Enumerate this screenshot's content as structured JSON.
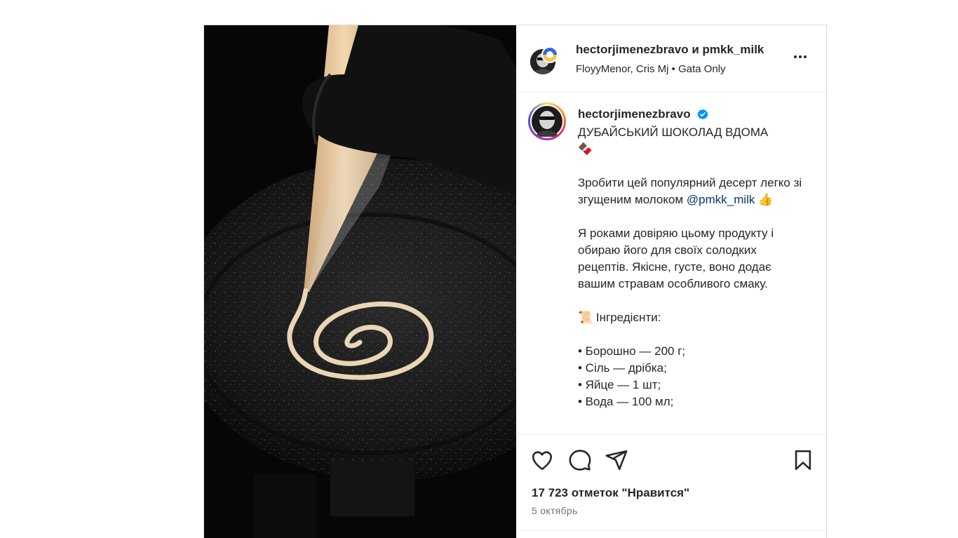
{
  "header": {
    "collab_title": "hectorjimenezbravo и pmkk_milk",
    "audio_line": "FloyyMenor, Cris Mj • Gata Only",
    "more_icon": "more-horizontal-icon"
  },
  "caption": {
    "username": "hectorjimenezbravo",
    "verified_icon": "verified-badge-icon",
    "line1": "ДУБАЙСЬКИЙ ШОКОЛАД ВДОМА",
    "line1_emoji": "🍫",
    "para2_part1": "Зробити цей популярний десерт легко зі згущеним молоком",
    "mention": "@pmkk_milk",
    "mention_emoji": "👍",
    "para3": "Я роками довіряю цьому продукту і обираю його для своїх солодких рецептів. Якісне, густе, воно додає вашим стравам особливого смаку.",
    "ingredients_emoji": "📜",
    "ingredients_title": "Інгредієнти:",
    "ingredients": [
      "• Борошно — 200 г;",
      "• Сіль — дрібка;",
      "• Яйце — 1 шт;",
      "• Вода — 100 мл;"
    ]
  },
  "actions": {
    "like_icon": "heart-icon",
    "comment_icon": "comment-icon",
    "share_icon": "share-icon",
    "save_icon": "bookmark-icon"
  },
  "likes_text": "17 723 отметок \"Нравится\"",
  "date_text": "5 октябрь",
  "colors": {
    "mention": "#00376b",
    "verified": "#0095f6",
    "secondary_text": "#737373",
    "border": "#dbdbdb"
  }
}
